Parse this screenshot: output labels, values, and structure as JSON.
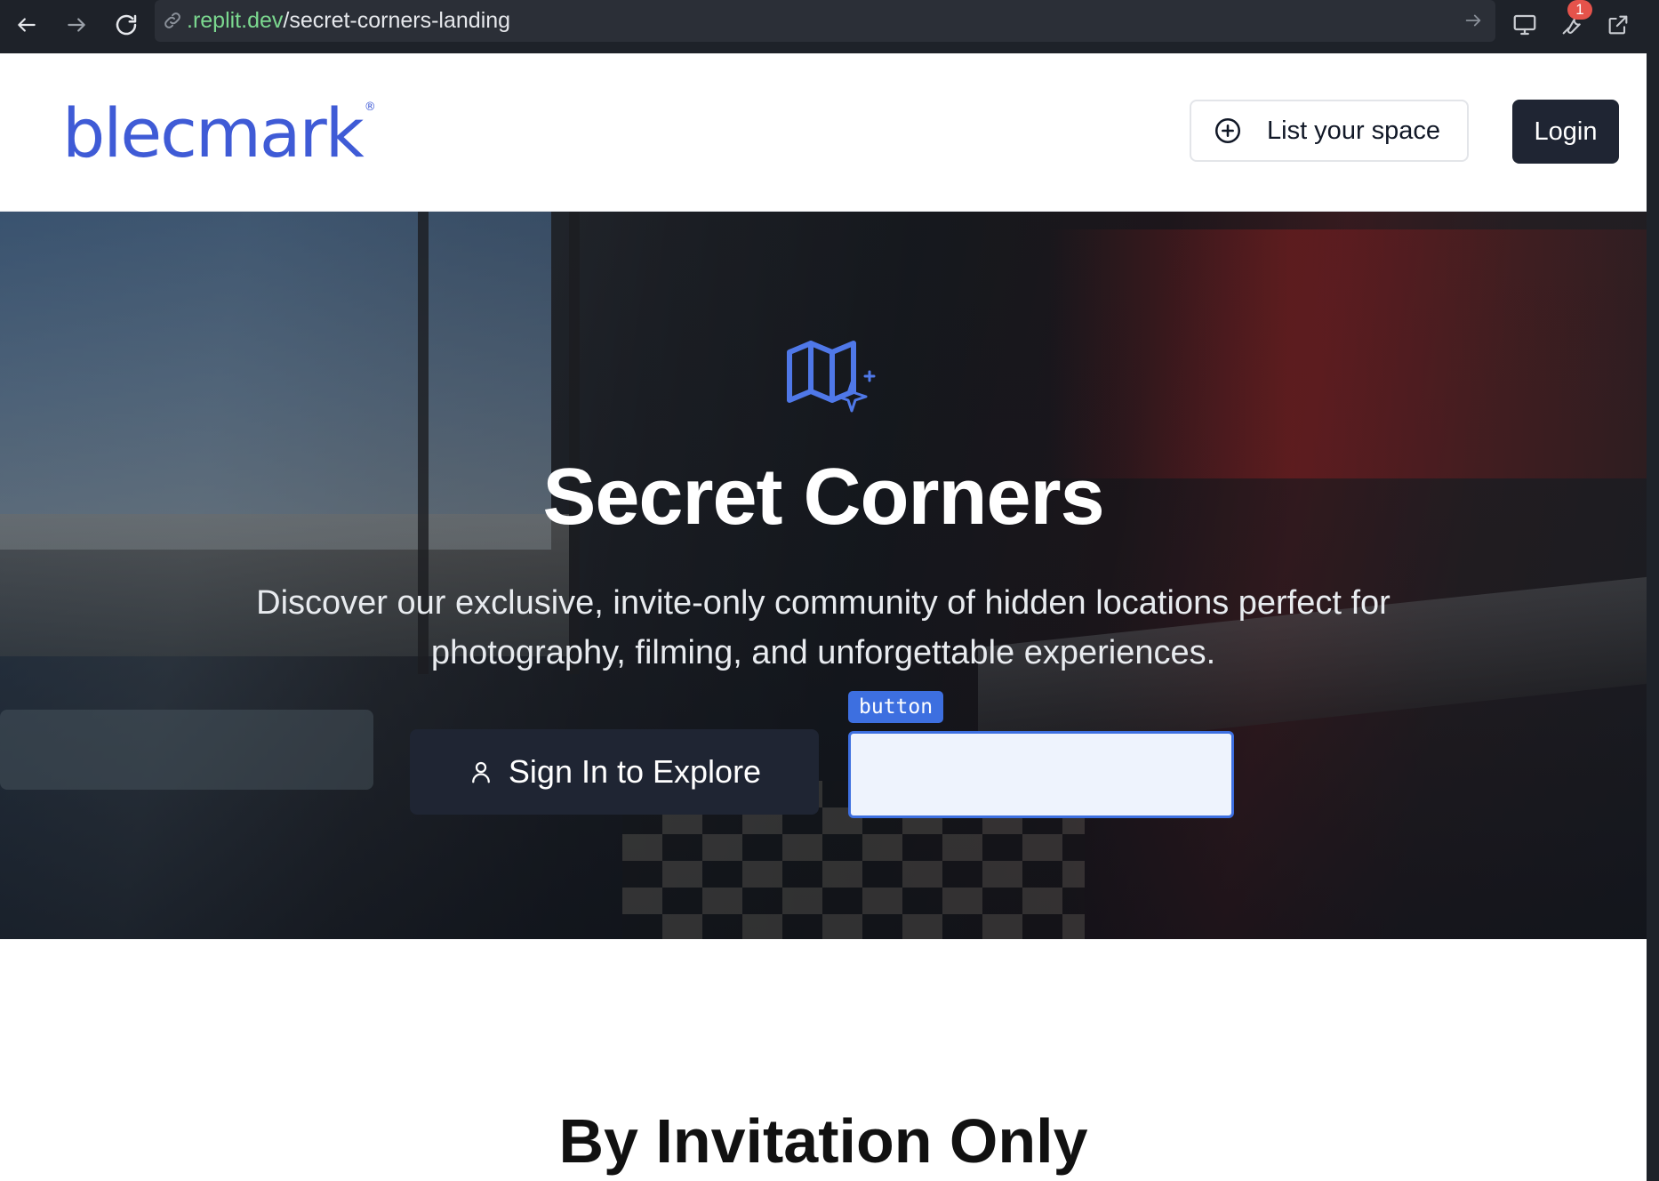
{
  "browser": {
    "url_domain": ".replit.dev",
    "url_path": "/secret-corners-landing",
    "notification_count": "1"
  },
  "header": {
    "logo_text": "blecmark",
    "list_space_label": "List your space",
    "login_label": "Login"
  },
  "hero": {
    "title": "Secret Corners",
    "subtitle": "Discover our exclusive, invite-only community of hidden locations perfect for photography, filming, and unforgettable experiences.",
    "signin_label": "Sign In to Explore",
    "debug_tag": "button"
  },
  "section": {
    "title": "By Invitation Only"
  },
  "colors": {
    "brand": "#3f5bd6",
    "accent": "#3d6fe0",
    "dark_button": "#1f2533"
  }
}
